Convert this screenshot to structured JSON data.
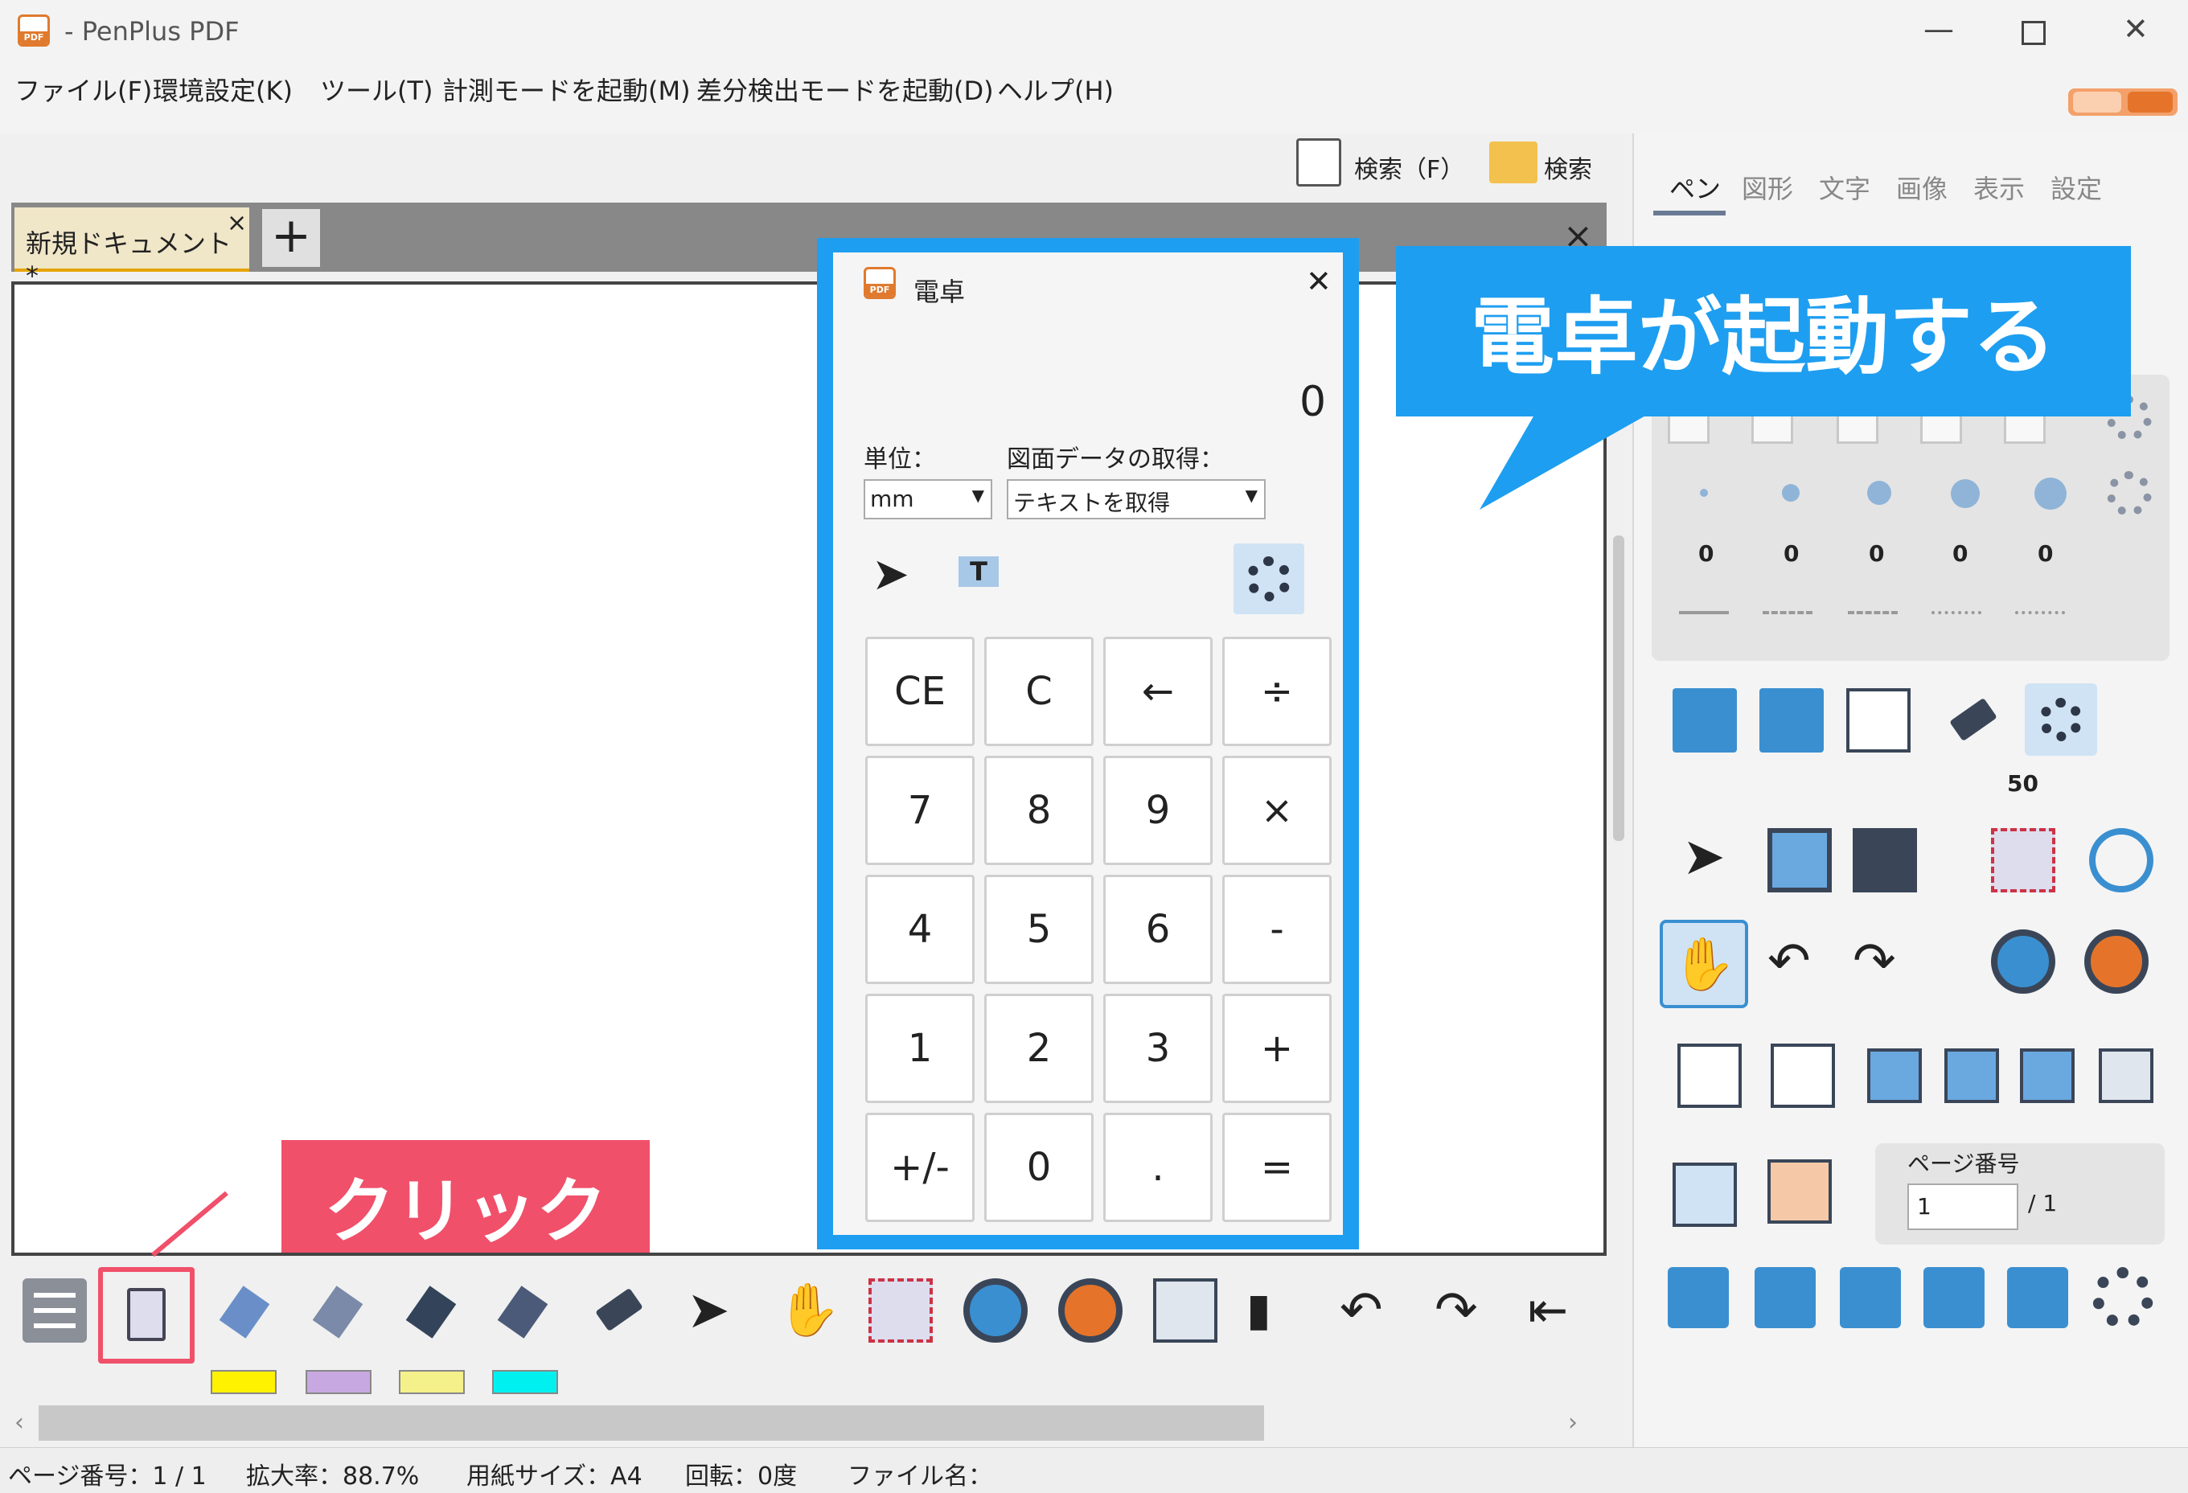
{
  "window": {
    "title": "- PenPlus PDF",
    "app_icon_text": "PDF"
  },
  "menu": [
    "ファイル(F)",
    "環境設定(K)",
    "ツール(T)",
    "計測モードを起動(M)",
    "差分検出モードを起動(D)",
    "ヘルプ(H)"
  ],
  "search_bar": {
    "search_label": "検索（F）",
    "folder_search_label": "検索"
  },
  "document": {
    "tab_label": "新規ドキュメント *",
    "tab_close": "×",
    "add_tab": "+",
    "close_canvas": "×"
  },
  "calculator": {
    "title": "電卓",
    "display": "0",
    "unit_label": "単位：",
    "unit_value": "mm",
    "data_label": "図面データの取得：",
    "data_value": "テキストを取得",
    "text_tool": "T",
    "keys": [
      [
        "CE",
        "C",
        "←",
        "÷"
      ],
      [
        "7",
        "8",
        "9",
        "×"
      ],
      [
        "4",
        "5",
        "6",
        "-"
      ],
      [
        "1",
        "2",
        "3",
        "+"
      ],
      [
        "+/-",
        "0",
        ".",
        "="
      ]
    ]
  },
  "annotations": {
    "callout": "電卓が起動する",
    "click": "クリック"
  },
  "right_panel": {
    "tabs": [
      "ペン",
      "図形",
      "文字",
      "画像",
      "表示",
      "設定"
    ],
    "pen_sizes": [
      "0",
      "0",
      "0",
      "0",
      "0"
    ],
    "eraser_size": "50",
    "page_number_label": "ページ番号",
    "page_number_value": "1",
    "page_total": "/ 1"
  },
  "status": {
    "page": "ページ番号：1 / 1",
    "zoom": "拡大率：88.7%",
    "paper": "用紙サイズ：A4",
    "rotation": "回転：0度",
    "file": "ファイル名："
  },
  "colors": {
    "accent_blue": "#1e9ef0",
    "annotation_red": "#f0506a",
    "highlight_yellow": "#fff200",
    "highlight_purple": "#c8a8e0",
    "highlight_checker": "#f4f08a",
    "highlight_cyan": "#00f0f0"
  }
}
